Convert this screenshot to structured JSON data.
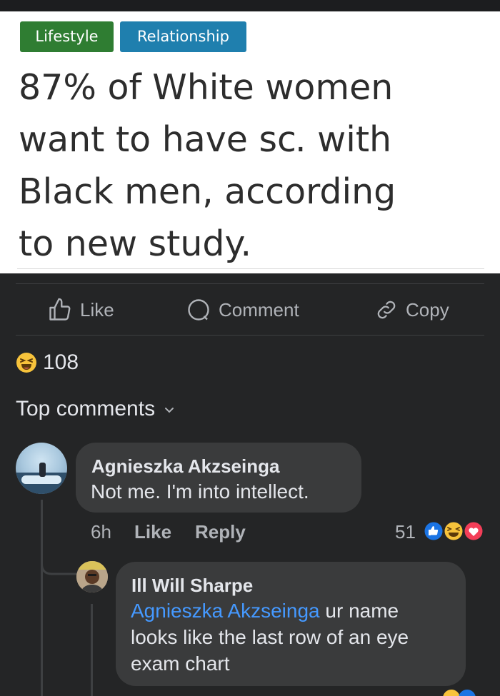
{
  "article": {
    "tags": [
      "Lifestyle",
      "Relationship"
    ],
    "headline": "87% of White women want to have sé․ with Black men, according to new study."
  },
  "actions": {
    "like": "Like",
    "comment": "Comment",
    "copy": "Copy"
  },
  "reactions": {
    "count": "108"
  },
  "comments_header": "Top comments",
  "comments": [
    {
      "author": "Agnieszka Akzseinga",
      "text": "Not me. I'm into intellect.",
      "time": "6h",
      "like_label": "Like",
      "reply_label": "Reply",
      "reaction_count": "51"
    }
  ],
  "replies": [
    {
      "author": "Ill Will Sharpe",
      "mention": "Agnieszka Akzseinga",
      "text_line1": " ur name",
      "text_line2": "looks like the last row of an eye",
      "text_line3": "exam chart"
    }
  ],
  "colors": {
    "background": "#242526",
    "bubble": "#3a3b3c",
    "mention": "#4599ff",
    "tag_lifestyle": "#2f7d32",
    "tag_relationship": "#1f7fae"
  }
}
